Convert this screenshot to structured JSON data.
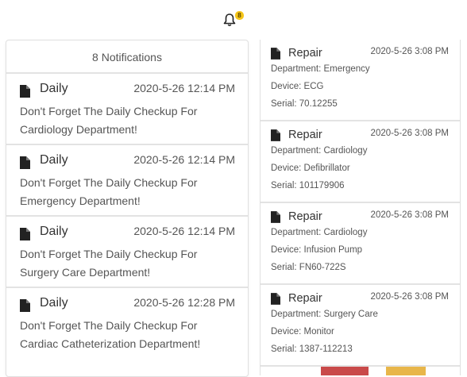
{
  "header": {
    "notification_count_badge": "8"
  },
  "left_panel": {
    "title": "8 Notifications",
    "items": [
      {
        "type": "Daily",
        "time": "2020-5-26 12:14 PM",
        "message": "Don't Forget The Daily Checkup For Cardiology Department!"
      },
      {
        "type": "Daily",
        "time": "2020-5-26 12:14 PM",
        "message": "Don't Forget The Daily Checkup For Emergency Department!"
      },
      {
        "type": "Daily",
        "time": "2020-5-26 12:14 PM",
        "message": "Don't Forget The Daily Checkup For Surgery Care Department!"
      },
      {
        "type": "Daily",
        "time": "2020-5-26 12:28 PM",
        "message": "Don't Forget The Daily Checkup For Cardiac Catheterization Department!"
      }
    ]
  },
  "right_panel": {
    "items": [
      {
        "type": "Repair",
        "time": "2020-5-26 3:08 PM",
        "department": "Department: Emergency",
        "device": "Device: ECG",
        "serial": "Serial: 70.12255"
      },
      {
        "type": "Repair",
        "time": "2020-5-26 3:08 PM",
        "department": "Department: Cardiology",
        "device": "Device: Defibrillator",
        "serial": "Serial: 101179906"
      },
      {
        "type": "Repair",
        "time": "2020-5-26 3:08 PM",
        "department": "Department: Cardiology",
        "device": "Device: Infusion Pump",
        "serial": "Serial: FN60-722S"
      },
      {
        "type": "Repair",
        "time": "2020-5-26 3:08 PM",
        "department": "Department: Surgery Care",
        "device": "Device: Monitor",
        "serial": "Serial: 1387-112213"
      }
    ]
  },
  "icons": {
    "bell": "bell-icon",
    "document": "document-icon"
  },
  "colors": {
    "badge": "#f5c518",
    "divider": "#e3e3e3",
    "text": "#555555",
    "title_text": "#333333"
  }
}
